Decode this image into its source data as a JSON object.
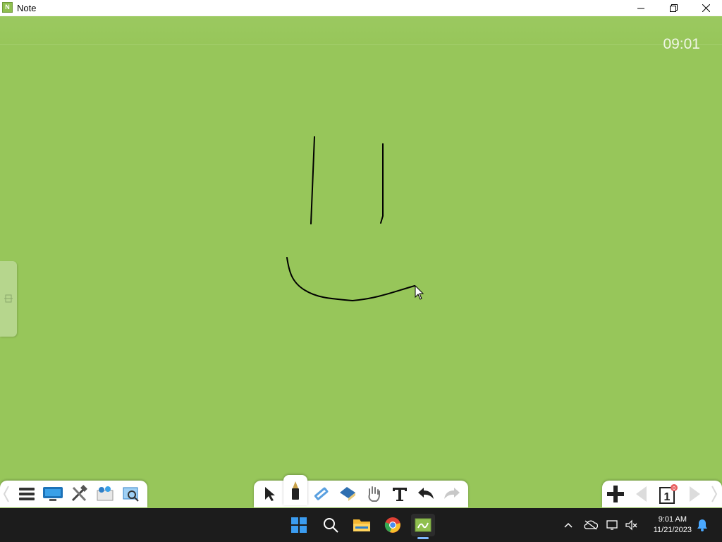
{
  "window": {
    "title": "Note",
    "app_icon": "note-app-icon"
  },
  "window_controls": {
    "minimize": "minimize-icon",
    "maximize": "restore-icon",
    "close": "close-icon"
  },
  "canvas": {
    "clock": "09:01",
    "background": "#97c65a"
  },
  "toolbars": {
    "left": [
      "chevron-left-icon",
      "menu-icon",
      "screen-icon",
      "tools-icon",
      "gallery-icon",
      "image-zoom-icon"
    ],
    "center": [
      "select-pointer-icon",
      "pen-icon",
      "highlighter-icon",
      "eraser-icon",
      "hand-icon",
      "text-icon",
      "undo-icon",
      "redo-icon"
    ],
    "right": [
      "add-page-icon",
      "prev-page-icon",
      "page-icon",
      "next-page-icon",
      "chevron-right-icon"
    ],
    "page_number": "1",
    "page_badge": "0"
  },
  "taskbar": {
    "apps": [
      "windows-start-icon",
      "search-icon",
      "file-explorer-icon",
      "chrome-icon",
      "note-app-icon"
    ],
    "tray": [
      "chevron-up-icon",
      "cloud-off-icon",
      "network-icon",
      "volume-muted-icon",
      "notification-bell-icon"
    ],
    "time": "9:01 AM",
    "date": "11/21/2023"
  }
}
